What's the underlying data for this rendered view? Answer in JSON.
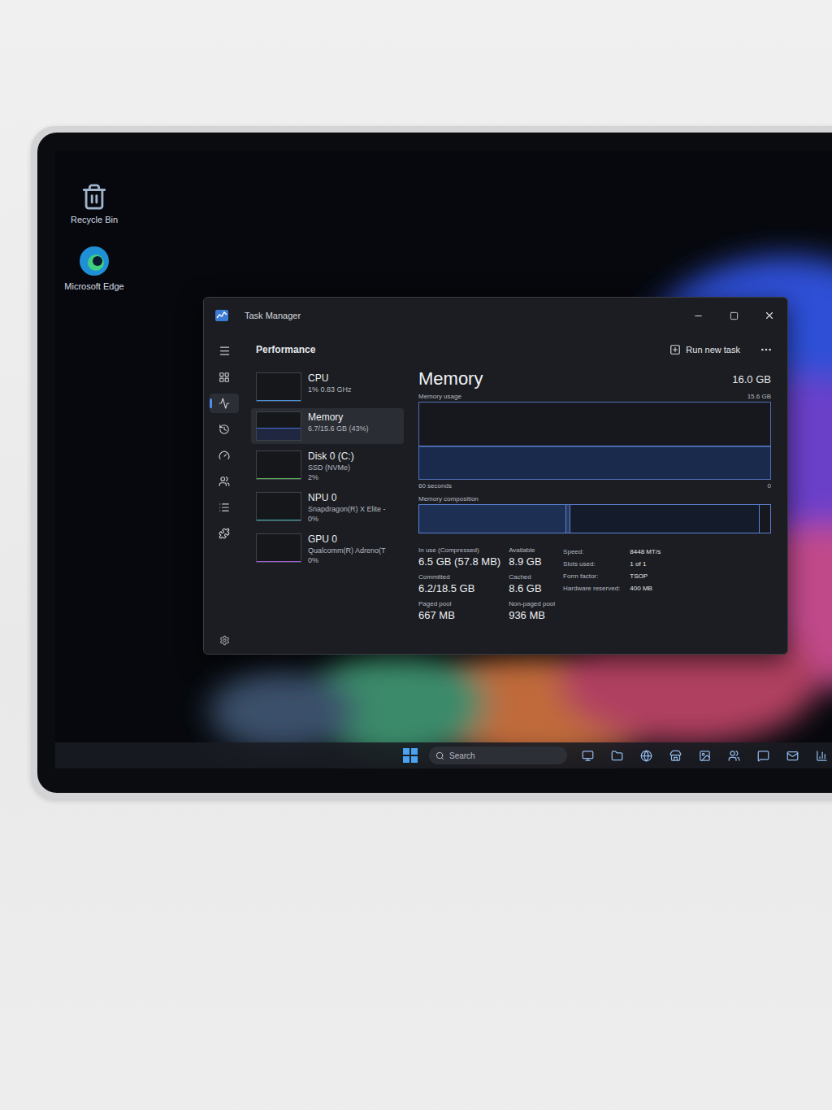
{
  "desktop_icons": [
    {
      "label": "Recycle Bin"
    },
    {
      "label": "Microsoft Edge"
    }
  ],
  "window": {
    "title": "Task Manager"
  },
  "header": {
    "title": "Performance",
    "run_new_task": "Run new task"
  },
  "nav": [
    {
      "selected": false
    },
    {
      "selected": true
    },
    {
      "selected": false
    },
    {
      "selected": false
    },
    {
      "selected": false
    },
    {
      "selected": false
    },
    {
      "selected": false
    }
  ],
  "devices": [
    {
      "name": "CPU",
      "details": [
        "1% 0.83 GHz"
      ],
      "selected": false,
      "level": 0.01,
      "color": "#4a8fd9"
    },
    {
      "name": "Memory",
      "details": [
        "6.7/15.6 GB (43%)"
      ],
      "selected": true,
      "level": 0.43,
      "color": "#4a6fd9"
    },
    {
      "name": "Disk 0 (C:)",
      "details": [
        "SSD (NVMe)",
        "2%"
      ],
      "selected": false,
      "level": 0.02,
      "color": "#5fb35f"
    },
    {
      "name": "NPU 0",
      "details": [
        "Snapdragon(R) X Elite -",
        "0%"
      ],
      "selected": false,
      "level": 0.0,
      "color": "#3fb0b0"
    },
    {
      "name": "GPU 0",
      "details": [
        "Qualcomm(R) Adreno(T",
        "0%"
      ],
      "selected": false,
      "level": 0.03,
      "color": "#a05fd0"
    }
  ],
  "memory": {
    "title": "Memory",
    "total": "16.0 GB",
    "usage_chart": {
      "label": "Memory usage",
      "max": "15.6 GB",
      "time": "60 seconds",
      "zero": "0",
      "max_value": 15.6,
      "values": [
        6.7,
        6.7,
        6.7,
        6.7,
        6.7,
        6.7,
        6.7,
        6.7,
        6.7,
        6.7,
        6.7,
        6.7,
        6.7,
        6.7,
        6.7,
        6.7,
        6.7,
        6.7,
        6.7,
        6.7
      ]
    },
    "composition": {
      "label": "Memory composition",
      "segments": [
        {
          "kind": "in-use",
          "level": 0.42
        },
        {
          "kind": "modified",
          "level": 0.01
        },
        {
          "kind": "standby",
          "level": 0.54
        },
        {
          "kind": "free",
          "level": 0.03
        }
      ]
    },
    "stats": [
      {
        "label": "In use (Compressed)",
        "value": "6.5 GB (57.8 MB)"
      },
      {
        "label": "Available",
        "value": "8.9 GB"
      },
      {
        "label": "Committed",
        "value": "6.2/18.5 GB"
      },
      {
        "label": "Cached",
        "value": "8.6 GB"
      },
      {
        "label": "Paged pool",
        "value": "667 MB"
      },
      {
        "label": "Non-paged pool",
        "value": "936 MB"
      }
    ],
    "specs": [
      {
        "label": "Speed:",
        "value": "8448 MT/s"
      },
      {
        "label": "Slots used:",
        "value": "1 of 1"
      },
      {
        "label": "Form factor:",
        "value": "TSOP"
      },
      {
        "label": "Hardware reserved:",
        "value": "400 MB"
      }
    ]
  },
  "taskbar": {
    "search": "Search"
  }
}
